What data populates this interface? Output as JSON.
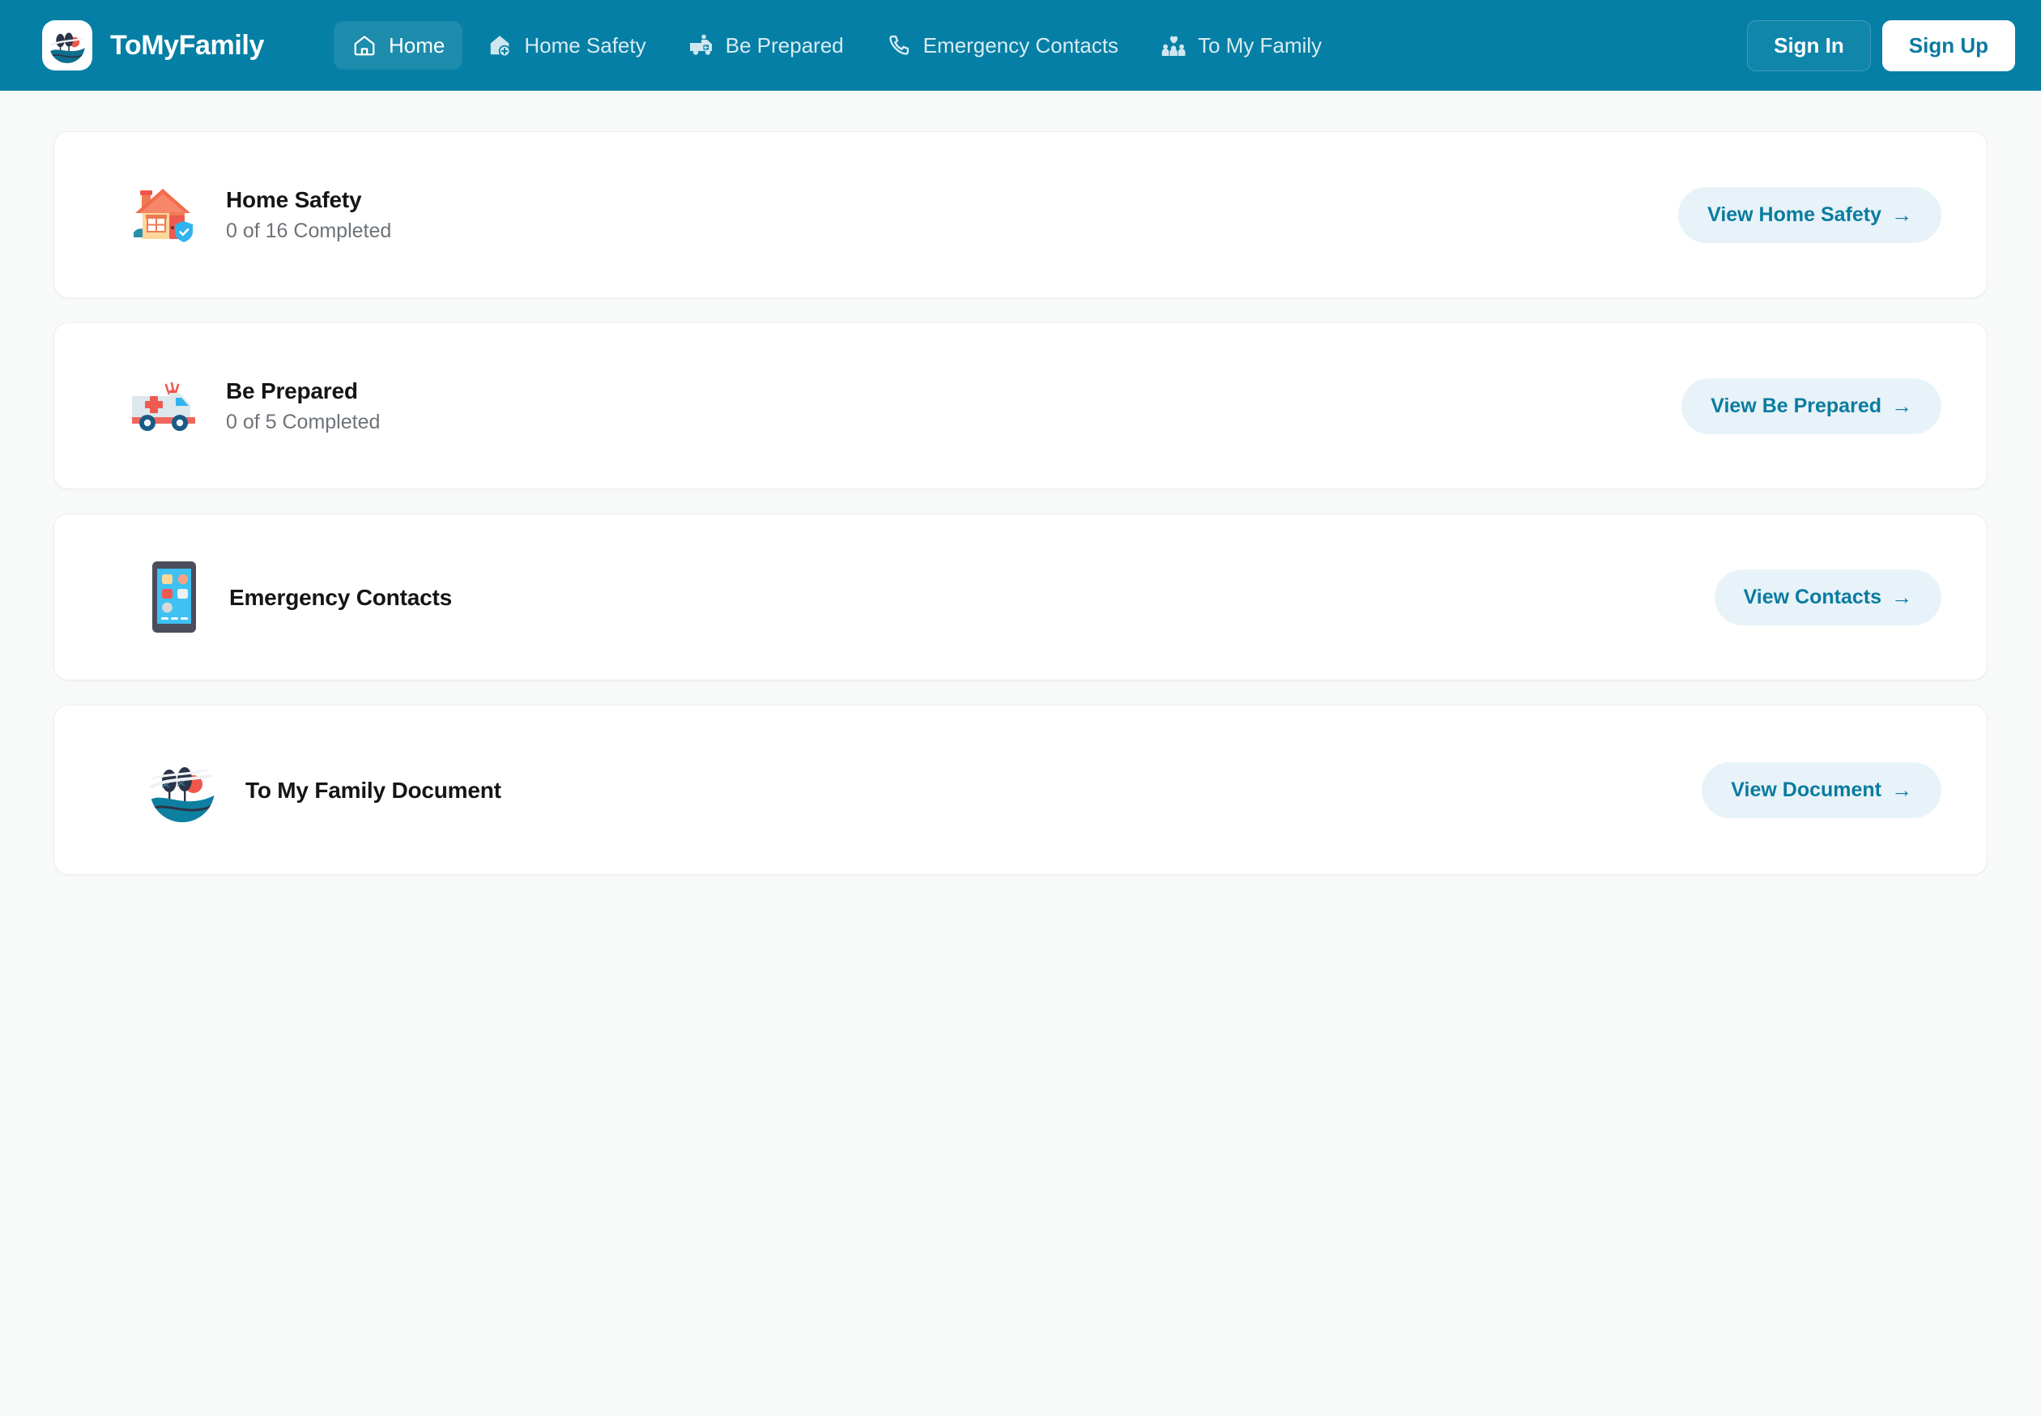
{
  "header": {
    "brand_name": "ToMyFamily",
    "logo_icon": "tomyfamily-landscape-logo",
    "nav": [
      {
        "label": "Home",
        "icon": "house-outline-icon",
        "active": true
      },
      {
        "label": "Home Safety",
        "icon": "house-shield-plus-icon",
        "active": false
      },
      {
        "label": "Be Prepared",
        "icon": "ambulance-icon",
        "active": false
      },
      {
        "label": "Emergency Contacts",
        "icon": "phone-handset-icon",
        "active": false
      },
      {
        "label": "To My Family",
        "icon": "family-heart-icon",
        "active": false
      }
    ],
    "sign_in_label": "Sign In",
    "sign_up_label": "Sign Up"
  },
  "colors": {
    "header_bg": "#057fa5",
    "active_nav_bg": "#1d8cad",
    "page_bg": "#f8f9f9",
    "card_bg": "#ffffff",
    "accent_text": "#0b7ba0",
    "pill_bg": "#e7f3f8",
    "title_text": "#131517",
    "muted_text": "#6e7378"
  },
  "cards": [
    {
      "title": "Home Safety",
      "subtitle": "0 of 16 Completed",
      "icon": "house-with-shield-icon",
      "button_label": "View Home Safety",
      "button_arrow": "→"
    },
    {
      "title": "Be Prepared",
      "subtitle": "0 of 5 Completed",
      "icon": "ambulance-icon",
      "button_label": "View Be Prepared",
      "button_arrow": "→"
    },
    {
      "title": "Emergency Contacts",
      "subtitle": "",
      "icon": "smartphone-icon",
      "button_label": "View Contacts",
      "button_arrow": "→"
    },
    {
      "title": "To My Family Document",
      "subtitle": "",
      "icon": "tomyfamily-landscape-logo",
      "button_label": "View Document",
      "button_arrow": "→"
    }
  ]
}
